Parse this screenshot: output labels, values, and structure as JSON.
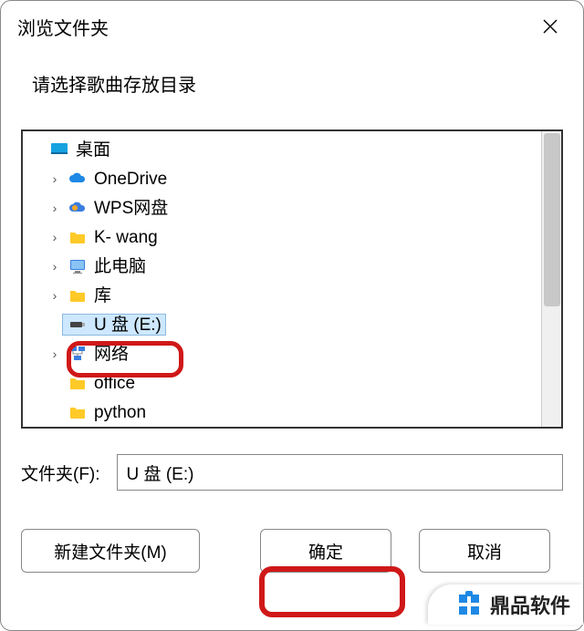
{
  "dialog": {
    "title": "浏览文件夹",
    "instruction": "请选择歌曲存放目录",
    "folder_label": "文件夹(F):",
    "folder_value": "U 盘 (E:)",
    "new_folder_btn": "新建文件夹(M)",
    "ok_btn": "确定",
    "cancel_btn": "取消"
  },
  "tree": {
    "root": {
      "label": "桌面",
      "icon": "desktop-blue"
    },
    "items": [
      {
        "label": "OneDrive",
        "icon": "cloud-blue",
        "expandable": true
      },
      {
        "label": "WPS网盘",
        "icon": "cloud-orange",
        "expandable": true
      },
      {
        "label": "K- wang",
        "icon": "folder",
        "expandable": true
      },
      {
        "label": "此电脑",
        "icon": "pc",
        "expandable": true
      },
      {
        "label": "库",
        "icon": "folder",
        "expandable": true
      },
      {
        "label": "U 盘 (E:)",
        "icon": "usb",
        "expandable": false,
        "selected": true
      },
      {
        "label": "网络",
        "icon": "network",
        "expandable": true
      },
      {
        "label": "office",
        "icon": "folder",
        "expandable": false
      },
      {
        "label": "python",
        "icon": "folder",
        "expandable": false
      }
    ]
  },
  "watermark": "鼎品软件"
}
